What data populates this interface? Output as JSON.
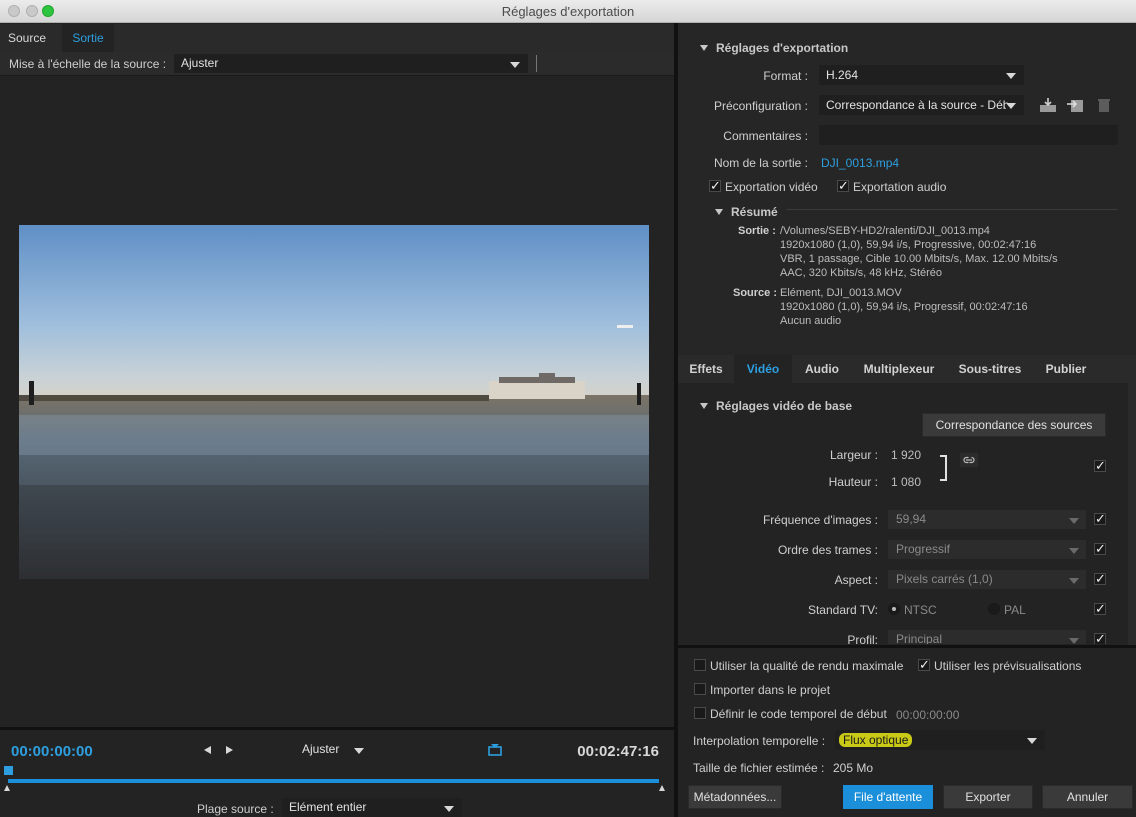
{
  "window": {
    "title": "Réglages d'exportation"
  },
  "left": {
    "tabs": [
      {
        "label": "Source"
      },
      {
        "label": "Sortie"
      }
    ],
    "scale_label": "Mise à l'échelle de la source :",
    "scale_value": "Ajuster",
    "timecode_in": "00:00:00:00",
    "timecode_out": "00:02:47:16",
    "fit_value": "Ajuster",
    "range_label": "Plage source :",
    "range_value": "Elément entier"
  },
  "export": {
    "header": "Réglages d'exportation",
    "format_label": "Format :",
    "format_value": "H.264",
    "preset_label": "Préconfiguration :",
    "preset_value": "Correspondance à la source - Déb",
    "comments_label": "Commentaires :",
    "comments_value": "",
    "output_name_label": "Nom de la sortie :",
    "output_name_value": "DJI_0013.mp4",
    "export_video_label": "Exportation vidéo",
    "export_audio_label": "Exportation audio",
    "summary_header": "Résumé",
    "summary_output_key": "Sortie :",
    "summary_output_lines": [
      "/Volumes/SEBY-HD2/ralenti/DJI_0013.mp4",
      "1920x1080 (1,0), 59,94 i/s, Progressive, 00:02:47:16",
      "VBR, 1 passage, Cible 10.00  Mbits/s, Max. 12.00  Mbits/s",
      "AAC, 320  Kbits/s, 48  kHz, Stéréo"
    ],
    "summary_source_key": "Source :",
    "summary_source_lines": [
      "Elément, DJI_0013.MOV",
      "1920x1080 (1,0), 59,94  i/s, Progressif, 00:02:47:16",
      "Aucun audio"
    ]
  },
  "tabs": [
    {
      "label": "Effets"
    },
    {
      "label": "Vidéo"
    },
    {
      "label": "Audio"
    },
    {
      "label": "Multiplexeur"
    },
    {
      "label": "Sous-titres"
    },
    {
      "label": "Publier"
    }
  ],
  "video": {
    "header": "Réglages vidéo de base",
    "match_button": "Correspondance des sources",
    "width_label": "Largeur :",
    "width_value": "1 920",
    "height_label": "Hauteur :",
    "height_value": "1 080",
    "fps_label": "Fréquence d'images :",
    "fps_value": "59,94",
    "field_label": "Ordre des trames :",
    "field_value": "Progressif",
    "aspect_label": "Aspect :",
    "aspect_value": "Pixels carrés (1,0)",
    "tv_label": "Standard TV:",
    "tv_ntsc": "NTSC",
    "tv_pal": "PAL",
    "profile_label": "Profil:",
    "profile_value": "Principal"
  },
  "bottom": {
    "max_quality_label": "Utiliser la qualité de rendu maximale",
    "use_previews_label": "Utiliser les prévisualisations",
    "import_label": "Importer dans le projet",
    "start_tc_label": "Définir le code temporel de début",
    "start_tc_value": "00:00:00:00",
    "interp_label": "Interpolation temporelle :",
    "interp_value": "Flux optique",
    "filesize_label": "Taille de fichier estimée :",
    "filesize_value": "205 Mo",
    "metadata_button": "Métadonnées...",
    "queue_button": "File d'attente",
    "export_button": "Exporter",
    "cancel_button": "Annuler"
  },
  "colors": {
    "accent": "#2d9fe0",
    "highlight": "#c9c917"
  }
}
